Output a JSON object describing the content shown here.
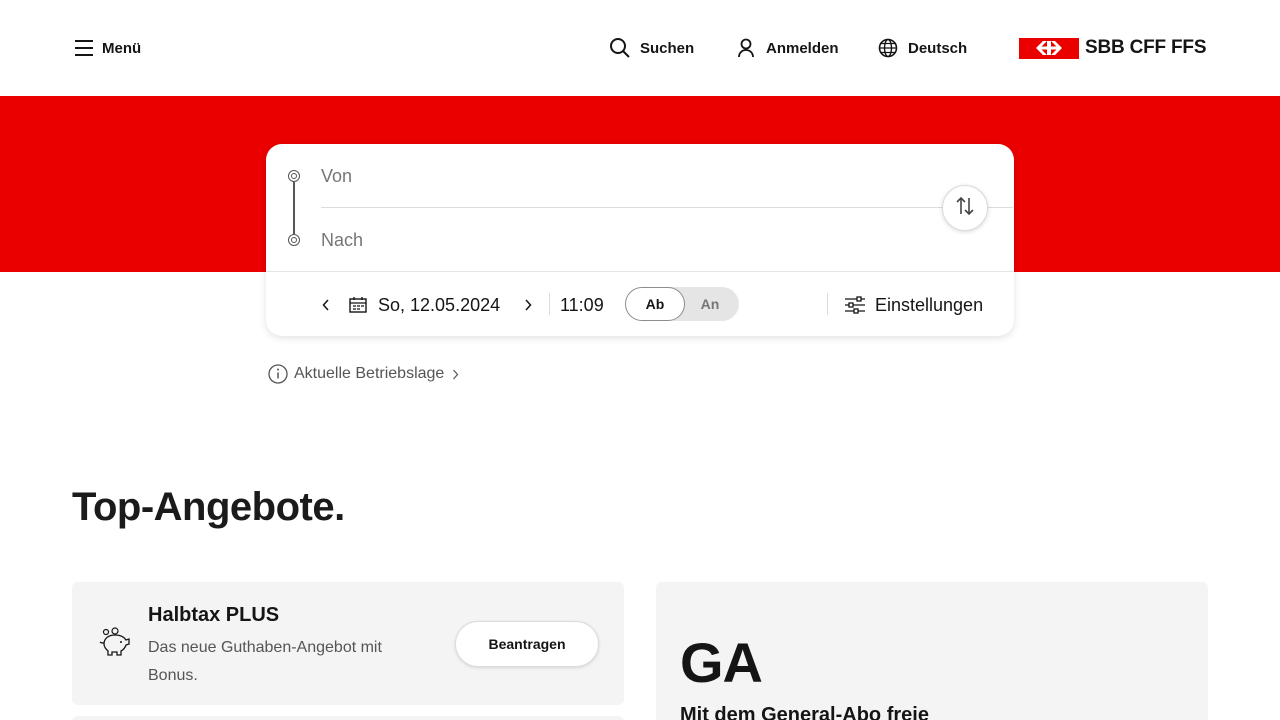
{
  "header": {
    "menu_label": "Menü",
    "search_label": "Suchen",
    "login_label": "Anmelden",
    "language_label": "Deutsch",
    "logo_text": "SBB CFF FFS"
  },
  "timetable": {
    "from_placeholder": "Von",
    "to_placeholder": "Nach",
    "date": "So, 12.05.2024",
    "time": "11:09",
    "toggle_departure": "Ab",
    "toggle_arrival": "An",
    "toggle_selected": "Ab",
    "settings_label": "Einstellungen"
  },
  "status_link": "Aktuelle Betriebslage",
  "offers": {
    "section_title": "Top-Angebote.",
    "halbtax": {
      "title": "Halbtax PLUS",
      "description": "Das neue Guthaben-Angebot mit Bonus.",
      "button": "Beantragen"
    },
    "ga": {
      "title": "GA",
      "subtitle": "Mit dem General-Abo freie"
    }
  },
  "colors": {
    "brand_red": "#eb0000",
    "text": "#151515",
    "card_bg": "#f4f4f4"
  }
}
